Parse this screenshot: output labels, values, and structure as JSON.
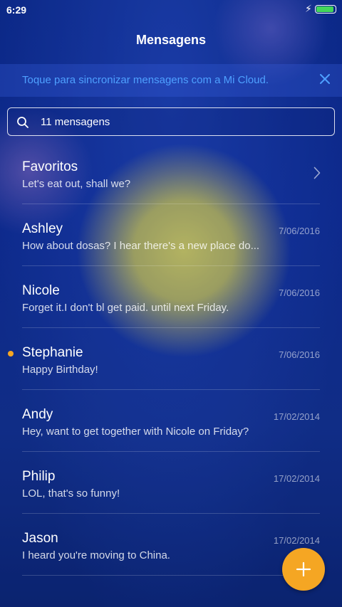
{
  "status_bar": {
    "time": "6:29",
    "battery_color": "#43d65a",
    "battery_level": 0.95
  },
  "header": {
    "title": "Mensagens"
  },
  "sync_banner": {
    "text": "Toque para sincronizar mensagens com a Mi Cloud.",
    "text_color": "#4ea0ff",
    "close_icon": "close-icon"
  },
  "search": {
    "placeholder": "11 mensagens",
    "icon": "search-icon"
  },
  "conversations": [
    {
      "name": "Favoritos",
      "preview": "Let's eat out, shall we?",
      "date": "",
      "unread": false,
      "chevron": true
    },
    {
      "name": "Ashley",
      "preview": "How about dosas? I hear there's a new place do...",
      "date": "7/06/2016",
      "unread": false,
      "chevron": false
    },
    {
      "name": "Nicole",
      "preview": "Forget it.I don't bl get paid. until next Friday.",
      "date": "7/06/2016",
      "unread": false,
      "chevron": false
    },
    {
      "name": "Stephanie",
      "preview": "Happy Birthday!",
      "date": "7/06/2016",
      "unread": true,
      "chevron": false
    },
    {
      "name": "Andy",
      "preview": "Hey, want to get together with Nicole on Friday?",
      "date": "17/02/2014",
      "unread": false,
      "chevron": false
    },
    {
      "name": "Philip",
      "preview": "LOL, that's so funny!",
      "date": "17/02/2014",
      "unread": false,
      "chevron": false
    },
    {
      "name": "Jason",
      "preview": "I heard you're moving to China.",
      "date": "17/02/2014",
      "unread": false,
      "chevron": false
    }
  ],
  "fab": {
    "icon": "plus-icon",
    "color": "#f5a623"
  },
  "colors": {
    "unread_dot": "#f5a623",
    "background": "#0e2d93"
  }
}
